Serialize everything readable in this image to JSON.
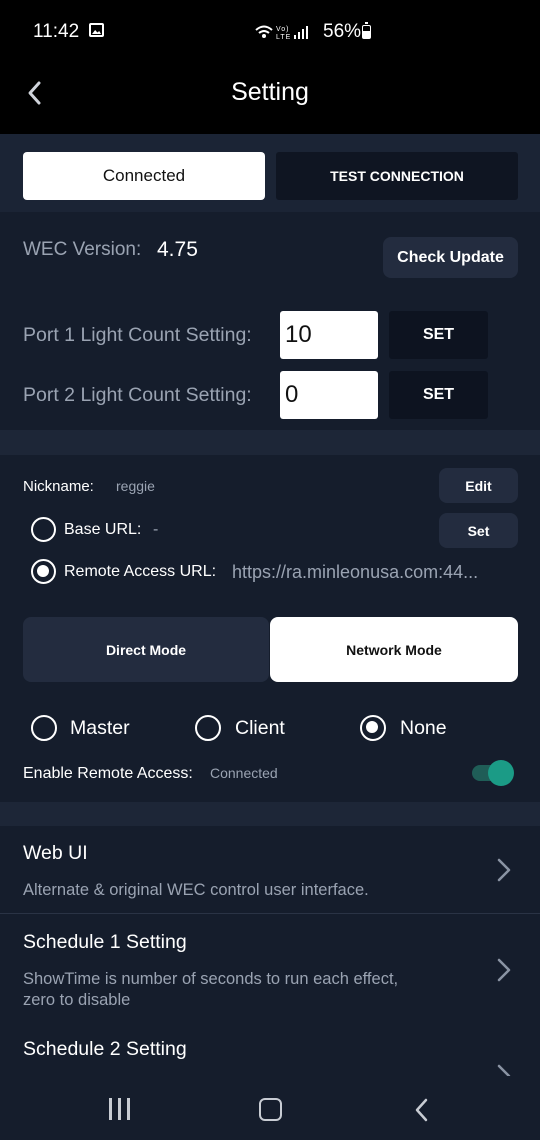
{
  "status_bar": {
    "time": "11:42",
    "network_text": "Vo) LTE",
    "battery": "56%"
  },
  "header": {
    "title": "Setting"
  },
  "connection": {
    "connected_label": "Connected",
    "test_label": "TEST CONNECTION"
  },
  "version": {
    "label": "WEC Version:",
    "value": "4.75",
    "check_update_label": "Check Update"
  },
  "ports": [
    {
      "label": "Port 1 Light Count Setting:",
      "value": "10",
      "set_label": "SET"
    },
    {
      "label": "Port 2 Light Count Setting:",
      "value": "0",
      "set_label": "SET"
    }
  ],
  "nickname": {
    "label": "Nickname:",
    "value": "reggie",
    "edit_label": "Edit"
  },
  "url_options": {
    "base": {
      "label": "Base URL:",
      "value": "-",
      "set_label": "Set",
      "selected": false
    },
    "remote": {
      "label": "Remote Access URL:",
      "value": "https://ra.minleonusa.com:44...",
      "selected": true
    }
  },
  "modes": {
    "direct_label": "Direct Mode",
    "network_label": "Network Mode",
    "selected": "Network Mode"
  },
  "roles": {
    "options": [
      "Master",
      "Client",
      "None"
    ],
    "selected": "None"
  },
  "remote_access": {
    "label": "Enable Remote Access:",
    "status": "Connected",
    "enabled": true,
    "accent_color": "#1b9b86"
  },
  "list_items": [
    {
      "title": "Web UI",
      "subtitle": "Alternate & original WEC control user interface."
    },
    {
      "title": "Schedule 1 Setting",
      "subtitle_line1": "ShowTime is number of seconds to run each effect,",
      "subtitle_line2": "zero to disable"
    },
    {
      "title": "Schedule 2 Setting"
    }
  ],
  "nav": {
    "icons": [
      "recent-apps-icon",
      "home-icon",
      "back-icon"
    ]
  }
}
